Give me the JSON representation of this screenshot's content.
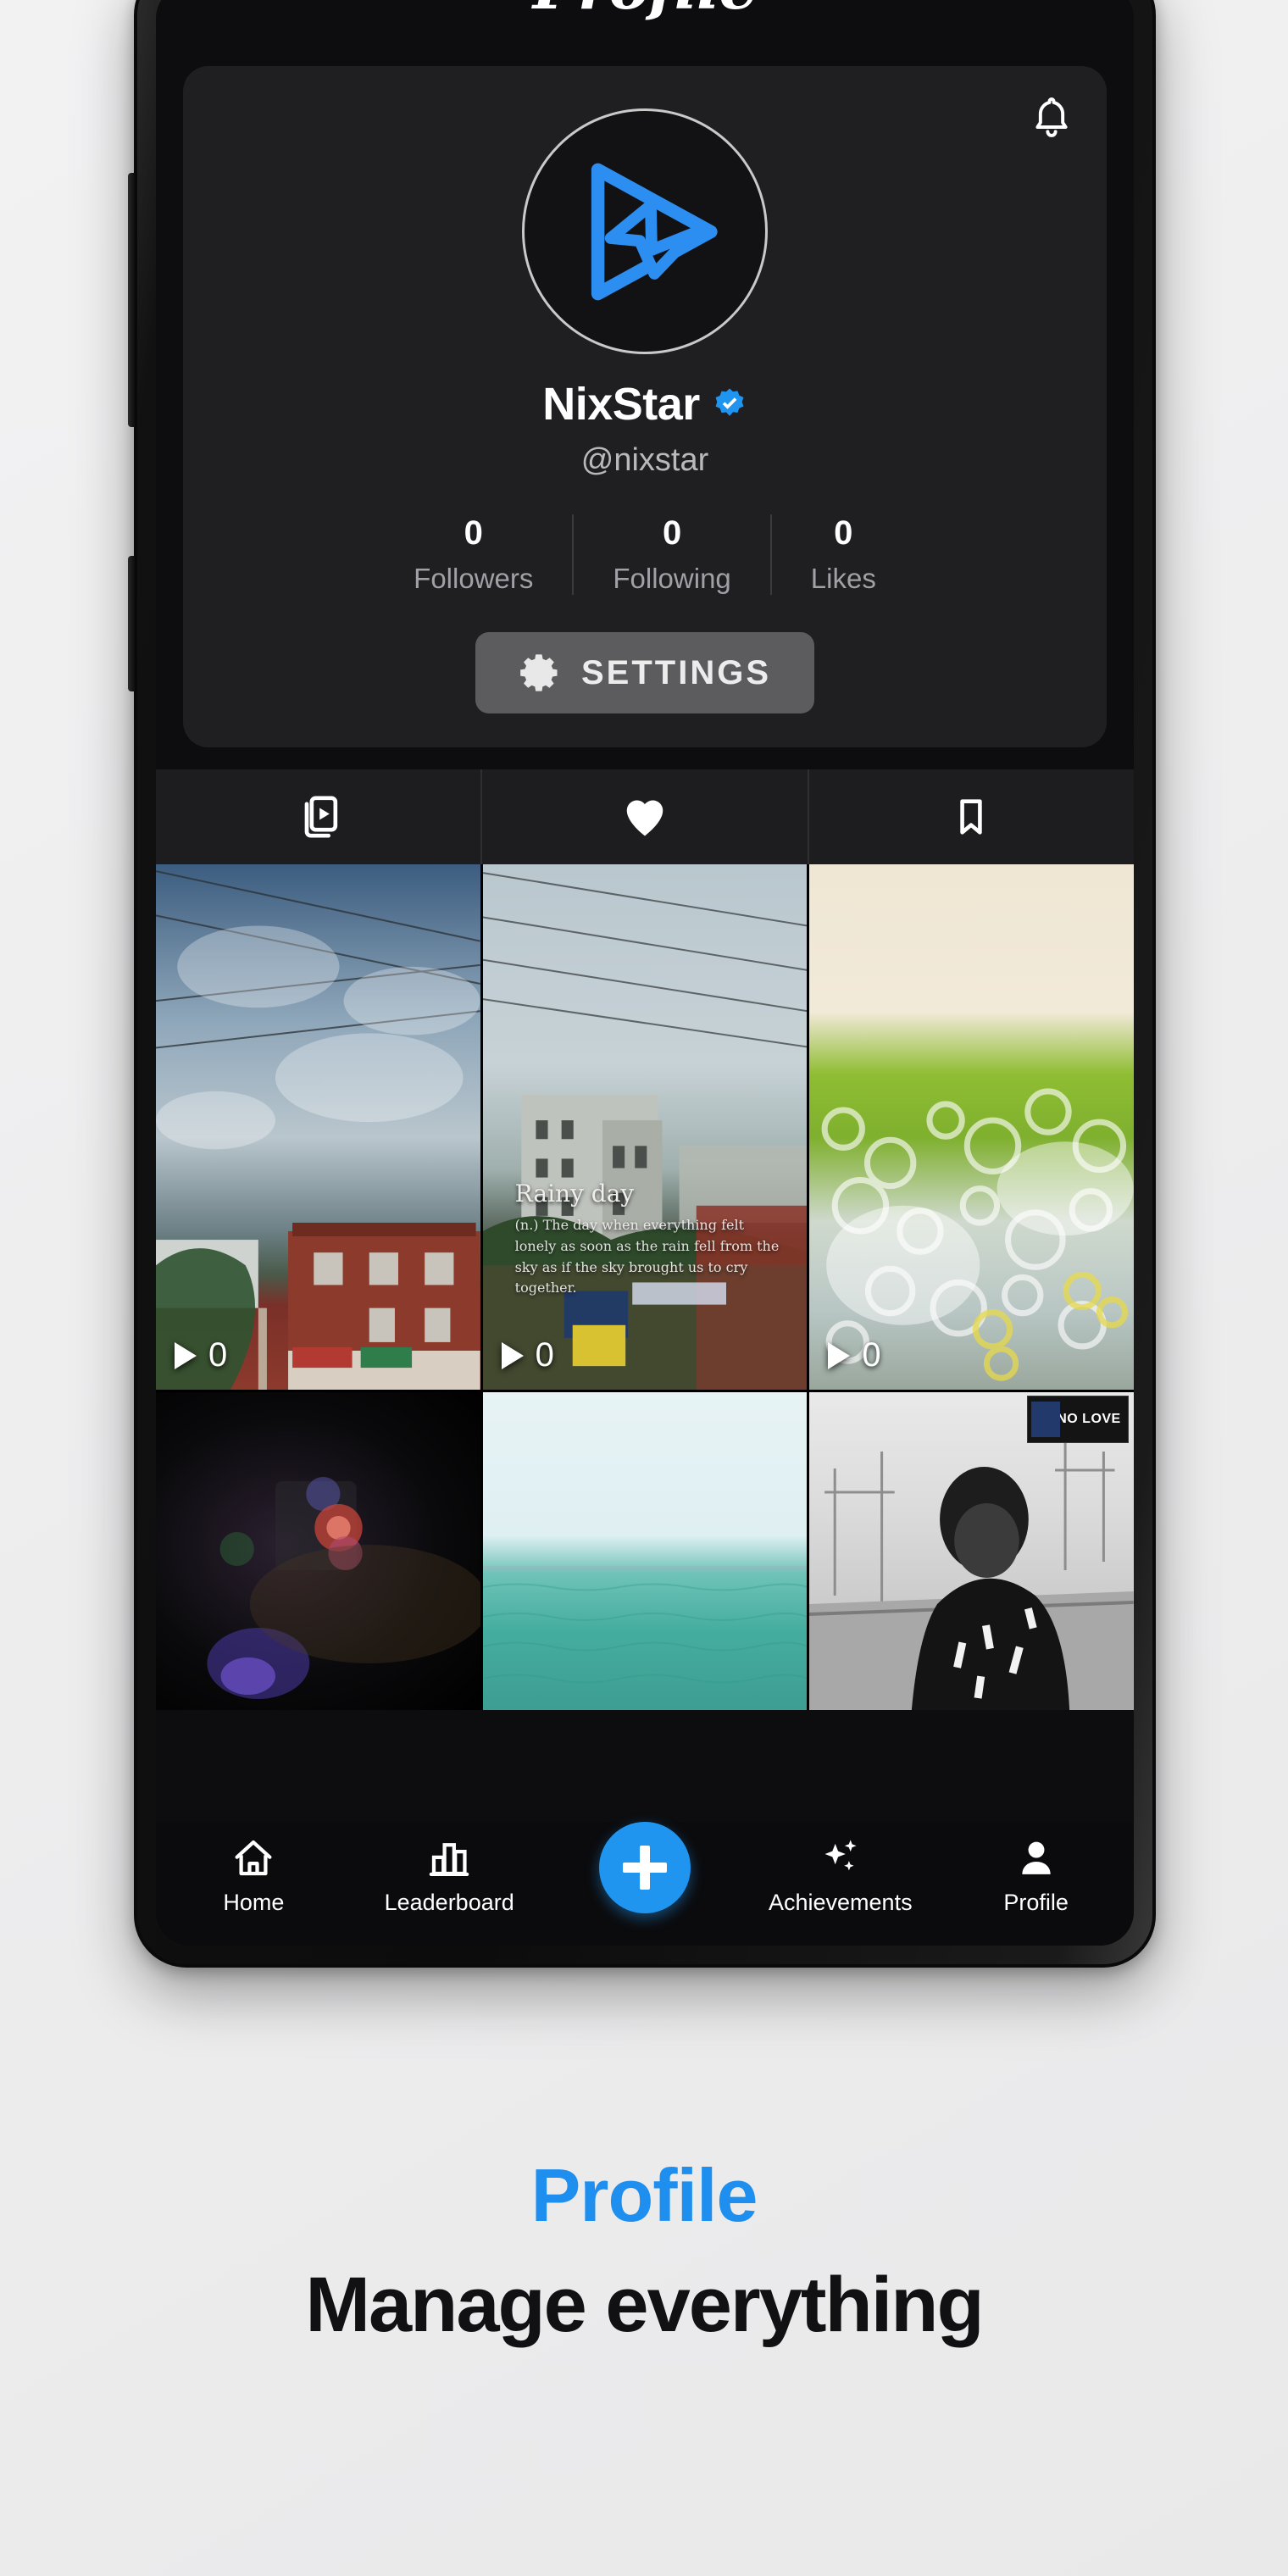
{
  "screen": {
    "header_title": "Profile",
    "notification_icon": "bell-icon"
  },
  "profile": {
    "avatar_icon": "play-star-logo-icon",
    "display_name": "NixStar",
    "verified_icon": "verified-badge-icon",
    "handle": "@nixstar",
    "stats": [
      {
        "value": "0",
        "label": "Followers"
      },
      {
        "value": "0",
        "label": "Following"
      },
      {
        "value": "0",
        "label": "Likes"
      }
    ],
    "settings_button": {
      "label": "SETTINGS",
      "icon": "gear-icon"
    }
  },
  "content_tabs": [
    {
      "id": "videos",
      "icon": "video-library-icon",
      "active": false
    },
    {
      "id": "liked",
      "icon": "heart-filled-icon",
      "active": true
    },
    {
      "id": "saved",
      "icon": "bookmark-icon",
      "active": false
    }
  ],
  "video_grid": {
    "row1": [
      {
        "id": "v1",
        "play_count": "0",
        "play_icon": "play-triangle-icon"
      },
      {
        "id": "v2",
        "play_count": "0",
        "play_icon": "play-triangle-icon",
        "overlay_title": "Rainy day",
        "overlay_body": "(n.) The day when everything felt lonely as soon as the rain fell from the sky as if the sky brought us to cry together."
      },
      {
        "id": "v3",
        "play_count": "0",
        "play_icon": "play-triangle-icon"
      }
    ],
    "row2": [
      {
        "id": "v4"
      },
      {
        "id": "v5"
      },
      {
        "id": "v6",
        "badge": "NO LOVE"
      }
    ]
  },
  "bottom_nav": [
    {
      "id": "home",
      "label": "Home",
      "icon": "home-icon"
    },
    {
      "id": "leaderboard",
      "label": "Leaderboard",
      "icon": "bar-chart-icon"
    },
    {
      "id": "create",
      "label": "",
      "icon": "plus-icon"
    },
    {
      "id": "achievements",
      "label": "Achievements",
      "icon": "sparkles-icon"
    },
    {
      "id": "profile",
      "label": "Profile",
      "icon": "person-icon"
    }
  ],
  "caption": {
    "title": "Profile",
    "subtitle": "Manage everything"
  },
  "colors": {
    "accent": "#1f95f0",
    "caption_title": "#1e8fef",
    "card_bg": "#1f1f21",
    "screen_bg": "#0d0d0f",
    "settings_bg": "#5c5c5e"
  }
}
